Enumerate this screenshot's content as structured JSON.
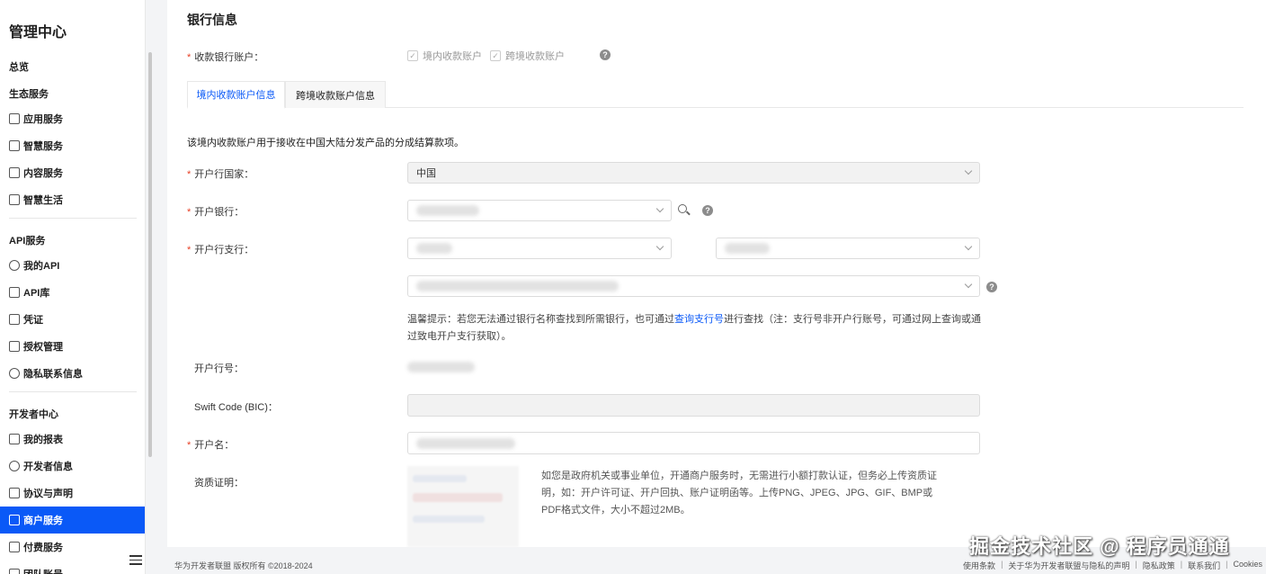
{
  "sidebar": {
    "title": "管理中心",
    "overview": "总览",
    "sections": [
      {
        "title": "生态服务",
        "items": [
          "应用服务",
          "智慧服务",
          "内容服务",
          "智慧生活"
        ]
      },
      {
        "title": "API服务",
        "items": [
          "我的API",
          "API库",
          "凭证",
          "授权管理",
          "隐私联系信息"
        ]
      },
      {
        "title": "开发者中心",
        "items": [
          "我的报表",
          "开发者信息",
          "协议与声明",
          "商户服务",
          "付费服务",
          "团队账号"
        ]
      }
    ],
    "active_item": "商户服务"
  },
  "main": {
    "title": "银行信息",
    "account_type": {
      "label": "收款银行账户：",
      "options": [
        "境内收款账户",
        "跨境收款账户"
      ]
    },
    "tabs": [
      "境内收款账户信息",
      "跨境收款账户信息"
    ],
    "description": "该境内收款账户用于接收在中国大陆分发产品的分成结算款项。",
    "country": {
      "label": "开户行国家：",
      "value": "中国"
    },
    "bank": {
      "label": "开户银行："
    },
    "branch": {
      "label": "开户行支行："
    },
    "tip": {
      "before": "温馨提示：若您无法通过银行名称查找到所需银行，也可通过",
      "link": "查询支行号",
      "after": "进行查找（注：支行号非开户行账号，可通过网上查询或通过致电开户支行获取）。"
    },
    "bank_code": {
      "label": "开户行号："
    },
    "swift": {
      "label": "Swift Code (BIC)："
    },
    "account_name": {
      "label": "开户名："
    },
    "qualification": {
      "label": "资质证明：",
      "desc": "如您是政府机关或事业单位，开通商户服务时，无需进行小额打款认证，但务必上传资质证明，如：开户许可证、开户回执、账户证明函等。上传PNG、JPEG、JPG、GIF、BMP或PDF格式文件，大小不超过2MB。"
    }
  },
  "footer": {
    "copyright": "华为开发者联盟 版权所有 ©2018-2024",
    "links": [
      "使用条款",
      "关于华为开发者联盟与隐私的声明",
      "隐私政策",
      "联系我们",
      "Cookies"
    ]
  },
  "watermark": "掘金技术社区 @ 程序员通通",
  "colors": {
    "accent": "#0a59f7",
    "required": "#e84026"
  }
}
